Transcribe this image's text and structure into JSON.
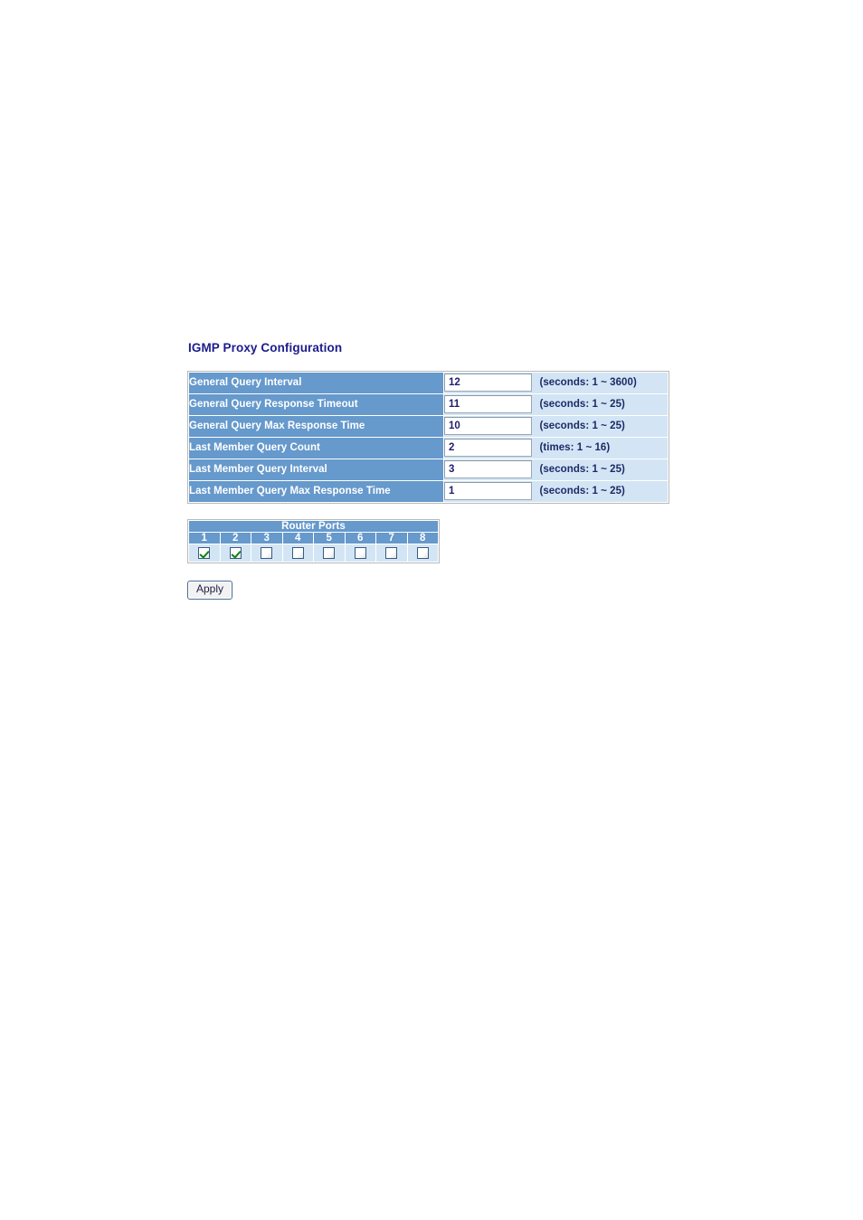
{
  "page": {
    "title": "IGMP Proxy Configuration"
  },
  "config": {
    "rows": [
      {
        "label": "General Query Interval",
        "value": "12",
        "hint": "(seconds: 1 ~ 3600)"
      },
      {
        "label": "General Query Response Timeout",
        "value": "11",
        "hint": "(seconds: 1 ~ 25)"
      },
      {
        "label": "General Query Max Response Time",
        "value": "10",
        "hint": "(seconds: 1 ~ 25)"
      },
      {
        "label": "Last Member Query Count",
        "value": "2",
        "hint": "(times: 1 ~ 16)"
      },
      {
        "label": "Last Member Query Interval",
        "value": "3",
        "hint": "(seconds: 1 ~ 25)"
      },
      {
        "label": "Last Member Query Max Response Time",
        "value": "1",
        "hint": "(seconds: 1 ~ 25)"
      }
    ]
  },
  "router_ports": {
    "title": "Router Ports",
    "ports": [
      {
        "number": "1",
        "checked": true
      },
      {
        "number": "2",
        "checked": true
      },
      {
        "number": "3",
        "checked": false
      },
      {
        "number": "4",
        "checked": false
      },
      {
        "number": "5",
        "checked": false
      },
      {
        "number": "6",
        "checked": false
      },
      {
        "number": "7",
        "checked": false
      },
      {
        "number": "8",
        "checked": false
      }
    ]
  },
  "actions": {
    "apply_label": "Apply"
  },
  "colors": {
    "header_blue": "#6699cc",
    "cell_light_blue": "#d3e5f5",
    "title_navy": "#1c1c8c",
    "hint_navy": "#1c2a66",
    "check_green": "#108010"
  }
}
